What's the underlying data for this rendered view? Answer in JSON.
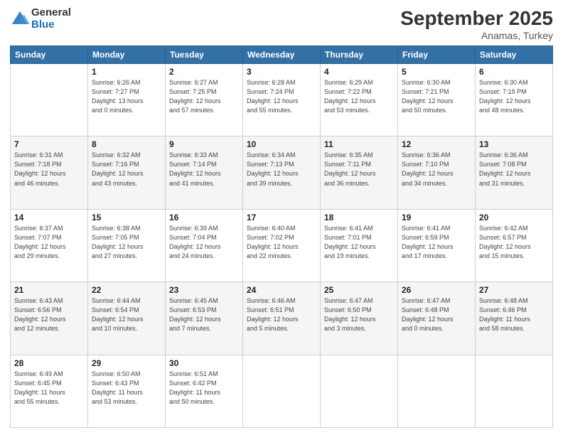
{
  "logo": {
    "general": "General",
    "blue": "Blue"
  },
  "title": "September 2025",
  "subtitle": "Anamas, Turkey",
  "days_of_week": [
    "Sunday",
    "Monday",
    "Tuesday",
    "Wednesday",
    "Thursday",
    "Friday",
    "Saturday"
  ],
  "weeks": [
    [
      {
        "day": "",
        "info": ""
      },
      {
        "day": "1",
        "info": "Sunrise: 6:26 AM\nSunset: 7:27 PM\nDaylight: 13 hours\nand 0 minutes."
      },
      {
        "day": "2",
        "info": "Sunrise: 6:27 AM\nSunset: 7:25 PM\nDaylight: 12 hours\nand 57 minutes."
      },
      {
        "day": "3",
        "info": "Sunrise: 6:28 AM\nSunset: 7:24 PM\nDaylight: 12 hours\nand 55 minutes."
      },
      {
        "day": "4",
        "info": "Sunrise: 6:29 AM\nSunset: 7:22 PM\nDaylight: 12 hours\nand 53 minutes."
      },
      {
        "day": "5",
        "info": "Sunrise: 6:30 AM\nSunset: 7:21 PM\nDaylight: 12 hours\nand 50 minutes."
      },
      {
        "day": "6",
        "info": "Sunrise: 6:30 AM\nSunset: 7:19 PM\nDaylight: 12 hours\nand 48 minutes."
      }
    ],
    [
      {
        "day": "7",
        "info": "Sunrise: 6:31 AM\nSunset: 7:18 PM\nDaylight: 12 hours\nand 46 minutes."
      },
      {
        "day": "8",
        "info": "Sunrise: 6:32 AM\nSunset: 7:16 PM\nDaylight: 12 hours\nand 43 minutes."
      },
      {
        "day": "9",
        "info": "Sunrise: 6:33 AM\nSunset: 7:14 PM\nDaylight: 12 hours\nand 41 minutes."
      },
      {
        "day": "10",
        "info": "Sunrise: 6:34 AM\nSunset: 7:13 PM\nDaylight: 12 hours\nand 39 minutes."
      },
      {
        "day": "11",
        "info": "Sunrise: 6:35 AM\nSunset: 7:11 PM\nDaylight: 12 hours\nand 36 minutes."
      },
      {
        "day": "12",
        "info": "Sunrise: 6:36 AM\nSunset: 7:10 PM\nDaylight: 12 hours\nand 34 minutes."
      },
      {
        "day": "13",
        "info": "Sunrise: 6:36 AM\nSunset: 7:08 PM\nDaylight: 12 hours\nand 31 minutes."
      }
    ],
    [
      {
        "day": "14",
        "info": "Sunrise: 6:37 AM\nSunset: 7:07 PM\nDaylight: 12 hours\nand 29 minutes."
      },
      {
        "day": "15",
        "info": "Sunrise: 6:38 AM\nSunset: 7:05 PM\nDaylight: 12 hours\nand 27 minutes."
      },
      {
        "day": "16",
        "info": "Sunrise: 6:39 AM\nSunset: 7:04 PM\nDaylight: 12 hours\nand 24 minutes."
      },
      {
        "day": "17",
        "info": "Sunrise: 6:40 AM\nSunset: 7:02 PM\nDaylight: 12 hours\nand 22 minutes."
      },
      {
        "day": "18",
        "info": "Sunrise: 6:41 AM\nSunset: 7:01 PM\nDaylight: 12 hours\nand 19 minutes."
      },
      {
        "day": "19",
        "info": "Sunrise: 6:41 AM\nSunset: 6:59 PM\nDaylight: 12 hours\nand 17 minutes."
      },
      {
        "day": "20",
        "info": "Sunrise: 6:42 AM\nSunset: 6:57 PM\nDaylight: 12 hours\nand 15 minutes."
      }
    ],
    [
      {
        "day": "21",
        "info": "Sunrise: 6:43 AM\nSunset: 6:56 PM\nDaylight: 12 hours\nand 12 minutes."
      },
      {
        "day": "22",
        "info": "Sunrise: 6:44 AM\nSunset: 6:54 PM\nDaylight: 12 hours\nand 10 minutes."
      },
      {
        "day": "23",
        "info": "Sunrise: 6:45 AM\nSunset: 6:53 PM\nDaylight: 12 hours\nand 7 minutes."
      },
      {
        "day": "24",
        "info": "Sunrise: 6:46 AM\nSunset: 6:51 PM\nDaylight: 12 hours\nand 5 minutes."
      },
      {
        "day": "25",
        "info": "Sunrise: 6:47 AM\nSunset: 6:50 PM\nDaylight: 12 hours\nand 3 minutes."
      },
      {
        "day": "26",
        "info": "Sunrise: 6:47 AM\nSunset: 6:48 PM\nDaylight: 12 hours\nand 0 minutes."
      },
      {
        "day": "27",
        "info": "Sunrise: 6:48 AM\nSunset: 6:46 PM\nDaylight: 11 hours\nand 58 minutes."
      }
    ],
    [
      {
        "day": "28",
        "info": "Sunrise: 6:49 AM\nSunset: 6:45 PM\nDaylight: 11 hours\nand 55 minutes."
      },
      {
        "day": "29",
        "info": "Sunrise: 6:50 AM\nSunset: 6:43 PM\nDaylight: 11 hours\nand 53 minutes."
      },
      {
        "day": "30",
        "info": "Sunrise: 6:51 AM\nSunset: 6:42 PM\nDaylight: 11 hours\nand 50 minutes."
      },
      {
        "day": "",
        "info": ""
      },
      {
        "day": "",
        "info": ""
      },
      {
        "day": "",
        "info": ""
      },
      {
        "day": "",
        "info": ""
      }
    ]
  ]
}
